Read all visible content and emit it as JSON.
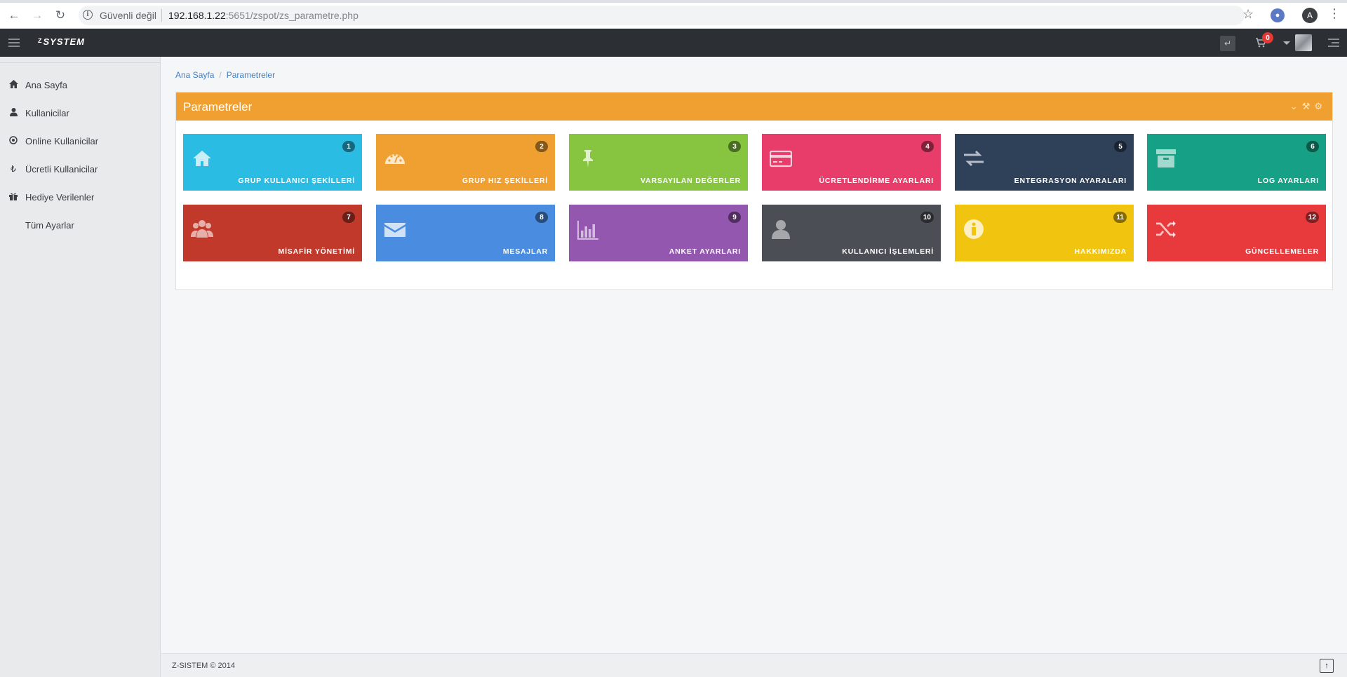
{
  "browser": {
    "security_label": "Güvenli değil",
    "url_host": "192.168.1.22",
    "url_rest": ":5651/zspot/zs_parametre.php",
    "profile_initial": "A"
  },
  "navbar": {
    "brand_prefix": "Z",
    "brand_name": "SYSTEM",
    "cart_count": "0"
  },
  "sidebar": {
    "items": [
      {
        "label": "Ana Sayfa",
        "icon": "home-icon"
      },
      {
        "label": "Kullanicilar",
        "icon": "user-icon"
      },
      {
        "label": "Online Kullanicilar",
        "icon": "circle-dot-icon"
      },
      {
        "label": "Ücretli Kullanicilar",
        "icon": "lira-icon"
      },
      {
        "label": "Hediye Verilenler",
        "icon": "gift-icon"
      },
      {
        "label": "Tüm Ayarlar",
        "icon": ""
      }
    ]
  },
  "breadcrumb": {
    "home": "Ana Sayfa",
    "current": "Parametreler"
  },
  "panel": {
    "title": "Parametreler"
  },
  "tiles": [
    {
      "num": "1",
      "label": "GRUP KULLANICI ŞEKİLLERİ",
      "icon": "home-icon",
      "color": "#2bbce4"
    },
    {
      "num": "2",
      "label": "GRUP HIZ ŞEKİLLERİ",
      "icon": "speedometer-icon",
      "color": "#f0a030"
    },
    {
      "num": "3",
      "label": "VARSAYILAN DEĞERLER",
      "icon": "pushpin-icon",
      "color": "#87c540"
    },
    {
      "num": "4",
      "label": "ÜCRETLENDİRME AYARLARI",
      "icon": "credit-card-icon",
      "color": "#e83c6b"
    },
    {
      "num": "5",
      "label": "ENTEGRASYON AYARALARI",
      "icon": "exchange-arrows-icon",
      "color": "#2f4059"
    },
    {
      "num": "6",
      "label": "LOG AYARLARI",
      "icon": "archive-icon",
      "color": "#16a085"
    },
    {
      "num": "7",
      "label": "MİSAFİR YÖNETİMİ",
      "icon": "users-group-icon",
      "color": "#c0392b"
    },
    {
      "num": "8",
      "label": "MESAJLAR",
      "icon": "envelope-icon",
      "color": "#4a8de0"
    },
    {
      "num": "9",
      "label": "ANKET AYARLARI",
      "icon": "bar-chart-icon",
      "color": "#9357b0"
    },
    {
      "num": "10",
      "label": "KULLANICI İŞLEMLERİ",
      "icon": "user-icon",
      "color": "#4b4f55"
    },
    {
      "num": "11",
      "label": "HAKKIMIZDA",
      "icon": "info-icon",
      "color": "#f1c40f"
    },
    {
      "num": "12",
      "label": "GÜNCELLEMELER",
      "icon": "shuffle-icon",
      "color": "#e8393c"
    }
  ],
  "footer": {
    "copyright": "Z-SISTEM © 2014"
  }
}
